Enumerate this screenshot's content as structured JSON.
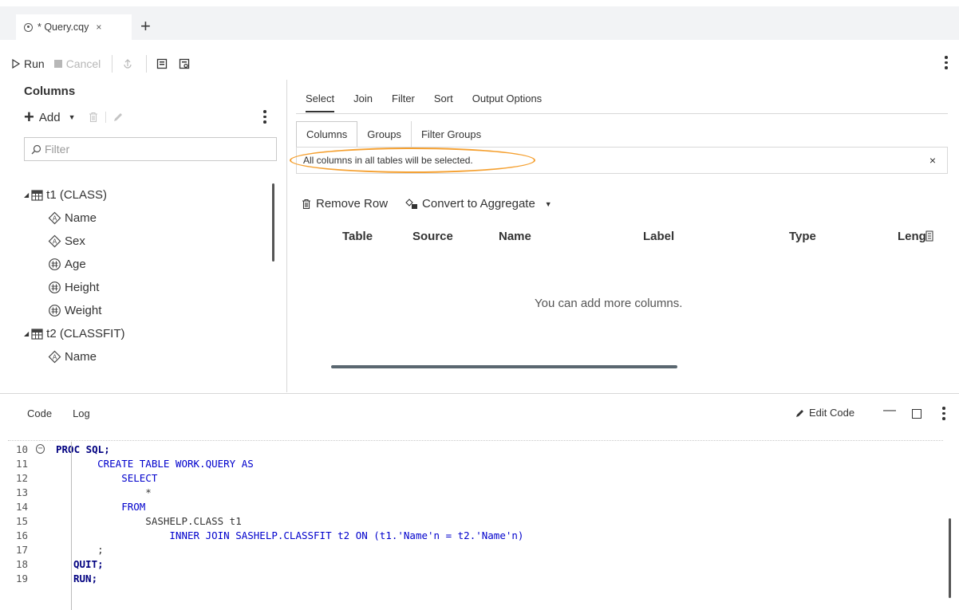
{
  "tab": {
    "title": "* Query.cqy",
    "close": "×",
    "add": "+"
  },
  "toolbar": {
    "run": "Run",
    "cancel": "Cancel"
  },
  "left": {
    "title": "Columns",
    "add_label": "Add",
    "filter_placeholder": "Filter",
    "tree": [
      {
        "label": "t1 (CLASS)",
        "children": [
          {
            "label": "Name",
            "icon": "char-column-icon"
          },
          {
            "label": "Sex",
            "icon": "char-column-icon"
          },
          {
            "label": "Age",
            "icon": "numeric-column-icon"
          },
          {
            "label": "Height",
            "icon": "numeric-column-icon"
          },
          {
            "label": "Weight",
            "icon": "numeric-column-icon"
          }
        ]
      },
      {
        "label": "t2 (CLASSFIT)",
        "children": [
          {
            "label": "Name",
            "icon": "char-column-icon"
          }
        ]
      }
    ]
  },
  "main_tabs": [
    "Select",
    "Join",
    "Filter",
    "Sort",
    "Output Options"
  ],
  "sub_tabs": [
    "Columns",
    "Groups",
    "Filter Groups"
  ],
  "notice": {
    "text": "All columns in all tables will be selected.",
    "close": "×"
  },
  "actions": {
    "remove_row": "Remove Row",
    "convert": "Convert to Aggregate"
  },
  "table_headers": [
    "Table",
    "Source",
    "Name",
    "Label",
    "Type",
    "Leng"
  ],
  "empty_message": "You can add more columns.",
  "bottom": {
    "tabs": [
      "Code",
      "Log"
    ],
    "edit_code": "Edit Code"
  },
  "code": {
    "line_numbers": [
      "10",
      "11",
      "12",
      "13",
      "14",
      "15",
      "16",
      "17",
      "18",
      "19"
    ],
    "lines": [
      "PROC SQL;",
      "    CREATE TABLE WORK.QUERY AS",
      "        SELECT",
      "            *",
      "        FROM",
      "            SASHELP.CLASS t1",
      "                INNER JOIN SASHELP.CLASSFIT t2 ON (t1.'Name'n = t2.'Name'n)",
      "    ;",
      "QUIT;",
      "RUN;"
    ]
  },
  "colors": {
    "highlight": "#f5a030",
    "keyword": "#0000cc",
    "string": "#800080"
  }
}
